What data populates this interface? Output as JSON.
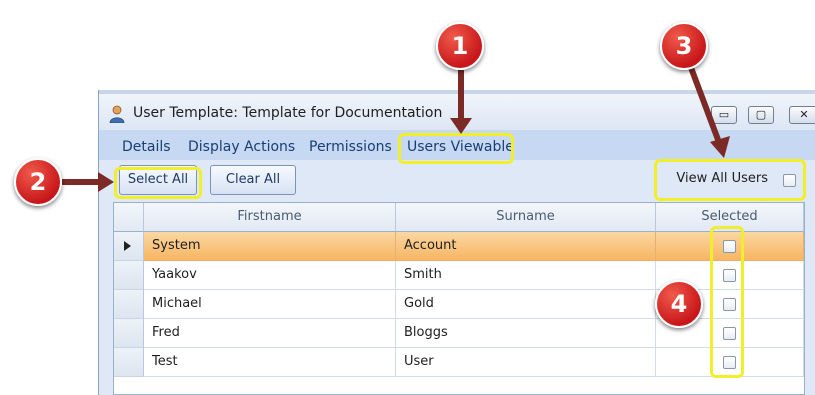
{
  "window": {
    "title": "User Template: Template for Documentation",
    "controls": {
      "minimize": "▭",
      "maximize": "▢",
      "close": "✕"
    }
  },
  "tabs": [
    {
      "label": "Details"
    },
    {
      "label": "Display Actions"
    },
    {
      "label": "Permissions"
    },
    {
      "label": "Users Viewable",
      "active": true
    }
  ],
  "toolbar": {
    "select_all": "Select All",
    "clear_all": "Clear All",
    "view_all_users_label": "View All Users",
    "view_all_users_checked": false
  },
  "grid": {
    "columns": [
      "Firstname",
      "Surname",
      "Selected"
    ],
    "rows": [
      {
        "firstname": "System",
        "surname": "Account",
        "selected": false,
        "current": true
      },
      {
        "firstname": "Yaakov",
        "surname": "Smith",
        "selected": false
      },
      {
        "firstname": "Michael",
        "surname": "Gold",
        "selected": false
      },
      {
        "firstname": "Fred",
        "surname": "Bloggs",
        "selected": false
      },
      {
        "firstname": "Test",
        "surname": "User",
        "selected": false
      }
    ]
  },
  "callouts": [
    "1",
    "2",
    "3",
    "4"
  ],
  "colors": {
    "highlight": "#f2ee2a",
    "callout": "#c8171b",
    "selected_row": "#f7b460",
    "tab_strip": "#c6d8f2"
  }
}
